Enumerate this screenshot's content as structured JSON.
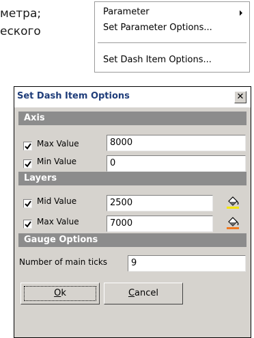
{
  "background_text": {
    "line1": "метра;",
    "line2": "еского"
  },
  "context_menu": {
    "items": [
      {
        "label": "Parameter",
        "has_submenu": true
      },
      {
        "label": "Set Parameter Options..."
      },
      {
        "label": "Set Dash Item Options..."
      }
    ]
  },
  "dialog": {
    "title": "Set Dash Item Options",
    "close_glyph": "✕",
    "axis": {
      "header": "Axis",
      "max_label": "Max Value",
      "max_value": "8000",
      "max_checked": true,
      "min_label": "Min Value",
      "min_value": "0",
      "min_checked": true
    },
    "layers": {
      "header": "Layers",
      "mid_label": "Mid Value",
      "mid_value": "2500",
      "mid_checked": true,
      "mid_color": "#f5e600",
      "max_label": "Max Value",
      "max_value": "7000",
      "max_checked": true,
      "max_color": "#f07820"
    },
    "gauge": {
      "header": "Gauge Options",
      "ticks_label": "Number of main ticks",
      "ticks_value": "9"
    },
    "buttons": {
      "ok_first": "O",
      "ok_rest": "k",
      "cancel_first": "C",
      "cancel_rest": "ancel"
    }
  }
}
